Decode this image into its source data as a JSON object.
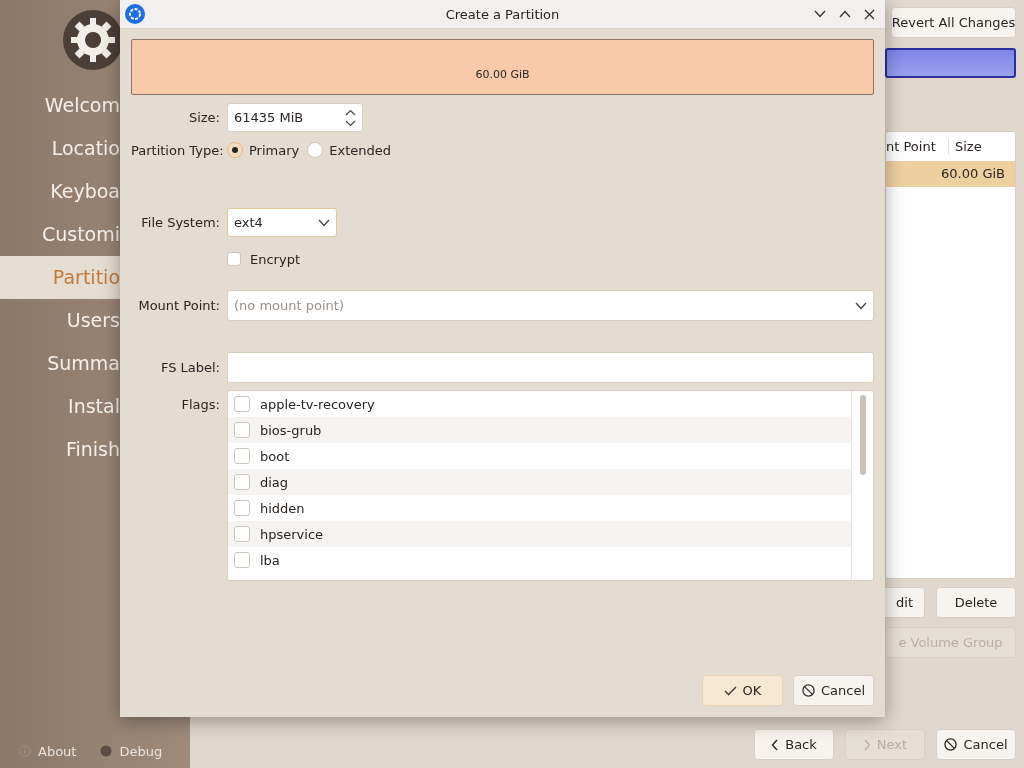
{
  "sidebar": {
    "items": [
      {
        "label": "Welcom",
        "selected": false
      },
      {
        "label": "Locatio",
        "selected": false
      },
      {
        "label": "Keyboa",
        "selected": false
      },
      {
        "label": "Customi",
        "selected": false
      },
      {
        "label": "Partitio",
        "selected": true
      },
      {
        "label": "Users",
        "selected": false
      },
      {
        "label": "Summa",
        "selected": false
      },
      {
        "label": "Instal",
        "selected": false
      },
      {
        "label": "Finish",
        "selected": false
      }
    ],
    "footer": [
      {
        "label": "About",
        "kind": "about"
      },
      {
        "label": "Debug",
        "kind": "debug"
      }
    ]
  },
  "background": {
    "revert_button": "Revert All Changes",
    "table": {
      "columns": [
        "nt Point",
        "Size"
      ],
      "rows": [
        {
          "size": "60.00 GiB",
          "selected": true
        }
      ]
    },
    "buttons": [
      {
        "label": "dit",
        "disabled": false
      },
      {
        "label": "Delete",
        "disabled": false
      },
      {
        "label": "e Volume Group",
        "disabled": true
      }
    ],
    "nav": [
      {
        "label": "Back",
        "kind": "back",
        "disabled": false
      },
      {
        "label": "Next",
        "kind": "next",
        "disabled": true
      },
      {
        "label": "Cancel",
        "kind": "cancel",
        "disabled": false
      }
    ]
  },
  "dialog": {
    "title": "Create a Partition",
    "bar_label": "60.00 GiB",
    "size": {
      "label": "Size:",
      "value": "61435 MiB"
    },
    "partition_type": {
      "label": "Partition Type:",
      "options": [
        {
          "label": "Primary",
          "selected": true
        },
        {
          "label": "Extended",
          "selected": false
        }
      ]
    },
    "file_system": {
      "label": "File System:",
      "value": "ext4"
    },
    "encrypt": {
      "label": "Encrypt",
      "checked": false
    },
    "mount_point": {
      "label": "Mount Point:",
      "placeholder": "(no mount point)"
    },
    "fs_label": {
      "label": "FS Label:"
    },
    "flags": {
      "label": "Flags:",
      "items": [
        {
          "label": "apple-tv-recovery",
          "checked": false
        },
        {
          "label": "bios-grub",
          "checked": false
        },
        {
          "label": "boot",
          "checked": false
        },
        {
          "label": "diag",
          "checked": false
        },
        {
          "label": "hidden",
          "checked": false
        },
        {
          "label": "hpservice",
          "checked": false
        },
        {
          "label": "lba",
          "checked": false
        }
      ]
    },
    "buttons": [
      {
        "label": "OK",
        "kind": "ok",
        "default": true
      },
      {
        "label": "Cancel",
        "kind": "cancel",
        "default": false
      }
    ]
  }
}
